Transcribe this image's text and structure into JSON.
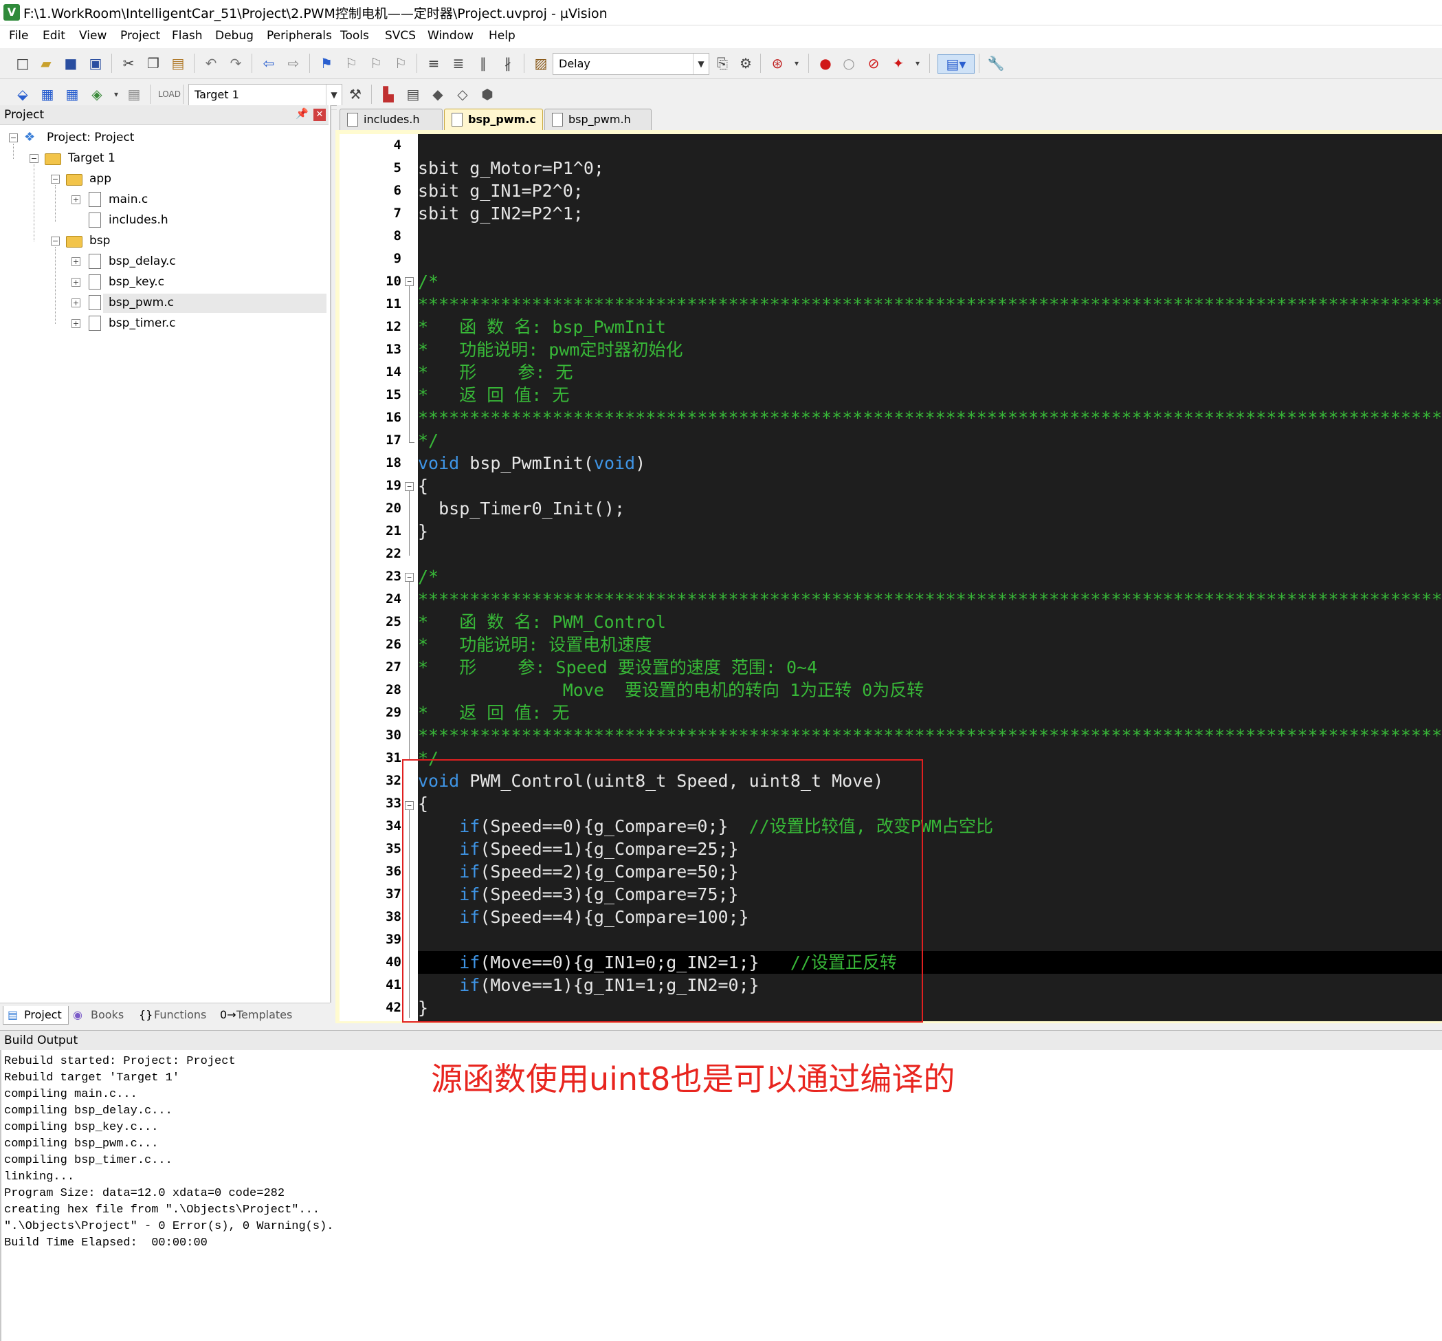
{
  "window": {
    "title": "F:\\1.WorkRoom\\IntelligentCar_51\\Project\\2.PWM控制电机——定时器\\Project.uvproj - µVision",
    "app_icon": "V"
  },
  "menu": [
    "File",
    "Edit",
    "View",
    "Project",
    "Flash",
    "Debug",
    "Peripherals",
    "Tools",
    "SVCS",
    "Window",
    "Help"
  ],
  "toolbar1": {
    "find_combo_value": "Delay"
  },
  "toolbar2": {
    "target_combo_value": "Target 1"
  },
  "project_panel": {
    "header": "Project",
    "pin_icon": "pin-icon",
    "close_icon": "close-icon",
    "tree": {
      "root": "Project: Project",
      "target": "Target 1",
      "group_app": "app",
      "app_files": [
        "main.c",
        "includes.h"
      ],
      "group_bsp": "bsp",
      "bsp_files": [
        "bsp_delay.c",
        "bsp_key.c",
        "bsp_pwm.c",
        "bsp_timer.c"
      ]
    },
    "bottom_tabs": [
      "Project",
      "Books",
      "Functions",
      "Templates"
    ]
  },
  "editor": {
    "tabs": [
      "includes.h",
      "bsp_pwm.c",
      "bsp_pwm.h"
    ],
    "active_tab": "bsp_pwm.c",
    "line_numbers": [
      "4",
      "5",
      "6",
      "7",
      "8",
      "9",
      "10",
      "11",
      "12",
      "13",
      "14",
      "15",
      "16",
      "17",
      "18",
      "19",
      "20",
      "21",
      "22",
      "23",
      "24",
      "25",
      "26",
      "27",
      "28",
      "29",
      "30",
      "31",
      "32",
      "33",
      "34",
      "35",
      "36",
      "37",
      "38",
      "39",
      "40",
      "41",
      "42"
    ],
    "lines": {
      "l4": "",
      "l5": "sbit g_Motor=P1^0;",
      "l6": "sbit g_IN1=P2^0;",
      "l7": "sbit g_IN2=P2^1;",
      "l10": "/*",
      "stars": "******************************************************************************************************************",
      "l12": "*   函 数 名: bsp_PwmInit",
      "l13": "*   功能说明: pwm定时器初始化",
      "l14": "*   形    参: 无",
      "l15": "*   返 回 值: 无",
      "l17": "*/",
      "l18_kw": "void",
      "l18_mid": " bsp_PwmInit(",
      "l18_kw2": "void",
      "l18_end": ")",
      "l19": "{",
      "l20": "  bsp_Timer0_Init();",
      "l21": "}",
      "l23": "/*",
      "l25": "*   函 数 名: PWM_Control",
      "l26": "*   功能说明: 设置电机速度",
      "l27": "*   形    参: Speed 要设置的速度 范围: 0~4",
      "l28": "              Move  要设置的电机的转向 1为正转 0为反转",
      "l29": "*   返 回 值: 无",
      "l31": "*/",
      "l32_kw": "void",
      "l32_rest": " PWM_Control(uint8_t Speed, uint8_t Move)",
      "l33": "{",
      "l34_code": "(Speed==0){g_Compare=0;}",
      "l34_cm": "  //设置比较值, 改变PWM占空比",
      "l35_code": "(Speed==1){g_Compare=25;}",
      "l36_code": "(Speed==2){g_Compare=50;}",
      "l37_code": "(Speed==3){g_Compare=75;}",
      "l38_code": "(Speed==4){g_Compare=100;}",
      "l40_code": "(Move==0){g_IN1=0;g_IN2=1;}",
      "l40_cm": "   //设置正反转",
      "l41_code": "(Move==1){g_IN1=1;g_IN2=0;}",
      "l42": "}",
      "if_kw": "if"
    }
  },
  "build_output": {
    "header": "Build Output",
    "lines": [
      "Rebuild started: Project: Project",
      "Rebuild target 'Target 1'",
      "compiling main.c...",
      "compiling bsp_delay.c...",
      "compiling bsp_key.c...",
      "compiling bsp_pwm.c...",
      "compiling bsp_timer.c...",
      "linking...",
      "Program Size: data=12.0 xdata=0 code=282",
      "creating hex file from \".\\Objects\\Project\"...",
      "\".\\Objects\\Project\" - 0 Error(s), 0 Warning(s).",
      "Build Time Elapsed:  00:00:00"
    ]
  },
  "annotation": "源函数使用uint8也是可以通过编译的",
  "colors": {
    "keyword": "#3f95e6",
    "comment": "#38b838",
    "number": "#2dd4c8",
    "editor_bg": "#1e1e1e",
    "annotation_red": "#e8251f"
  }
}
